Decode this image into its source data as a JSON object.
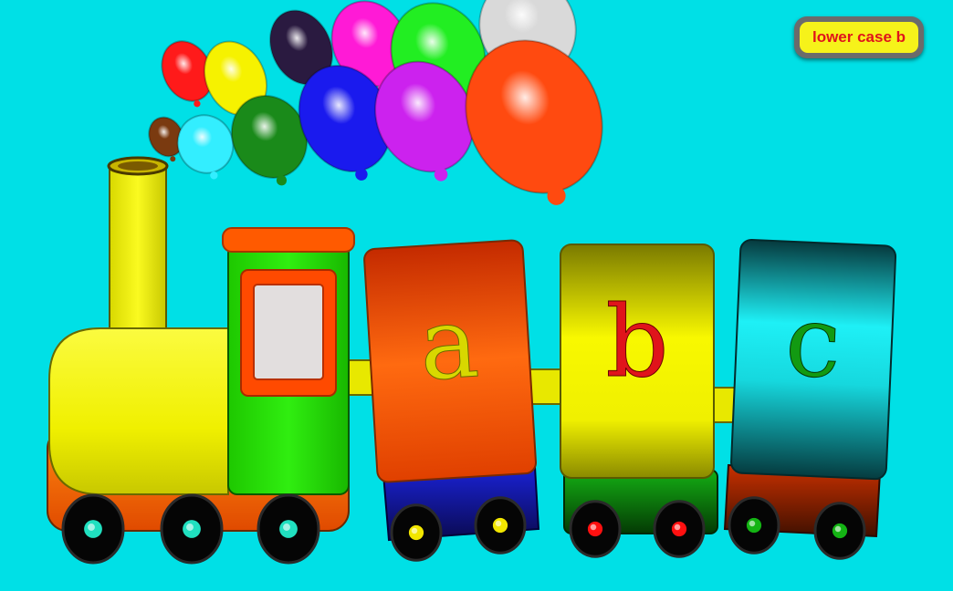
{
  "status_label": "lower case b",
  "cars": [
    {
      "letter": "a",
      "letter_color": "#d8d800",
      "body_color": "#ff5a00",
      "top_color": "#d63a00",
      "base_color": "#1a22d6",
      "wheel_hub": "#f2e600"
    },
    {
      "letter": "b",
      "letter_color": "#e0141b",
      "body_color": "#f5f500",
      "top_color": "#8c8c00",
      "base_color": "#009a00",
      "wheel_hub": "#ff1010"
    },
    {
      "letter": "c",
      "letter_color": "#129a12",
      "body_color": "#1ae8ee",
      "top_color": "#0a4e52",
      "base_color": "#c22800",
      "wheel_hub": "#14b414"
    }
  ],
  "balloon_colors": [
    "#ff1a1a",
    "#f6f200",
    "#2a1a40",
    "#ff1ad6",
    "#22ee22",
    "#d9d9d9",
    "#7a3a10",
    "#33eeff",
    "#1a8a1a",
    "#1a1aee",
    "#cc22ee",
    "#ff4a10"
  ],
  "engine_colors": {
    "boiler": "#f6f200",
    "cab": "#22dd00",
    "roof": "#ff5a00",
    "window": "#e2dede",
    "base": "#ff6a00",
    "wheel_hub": "#20e0c0"
  }
}
